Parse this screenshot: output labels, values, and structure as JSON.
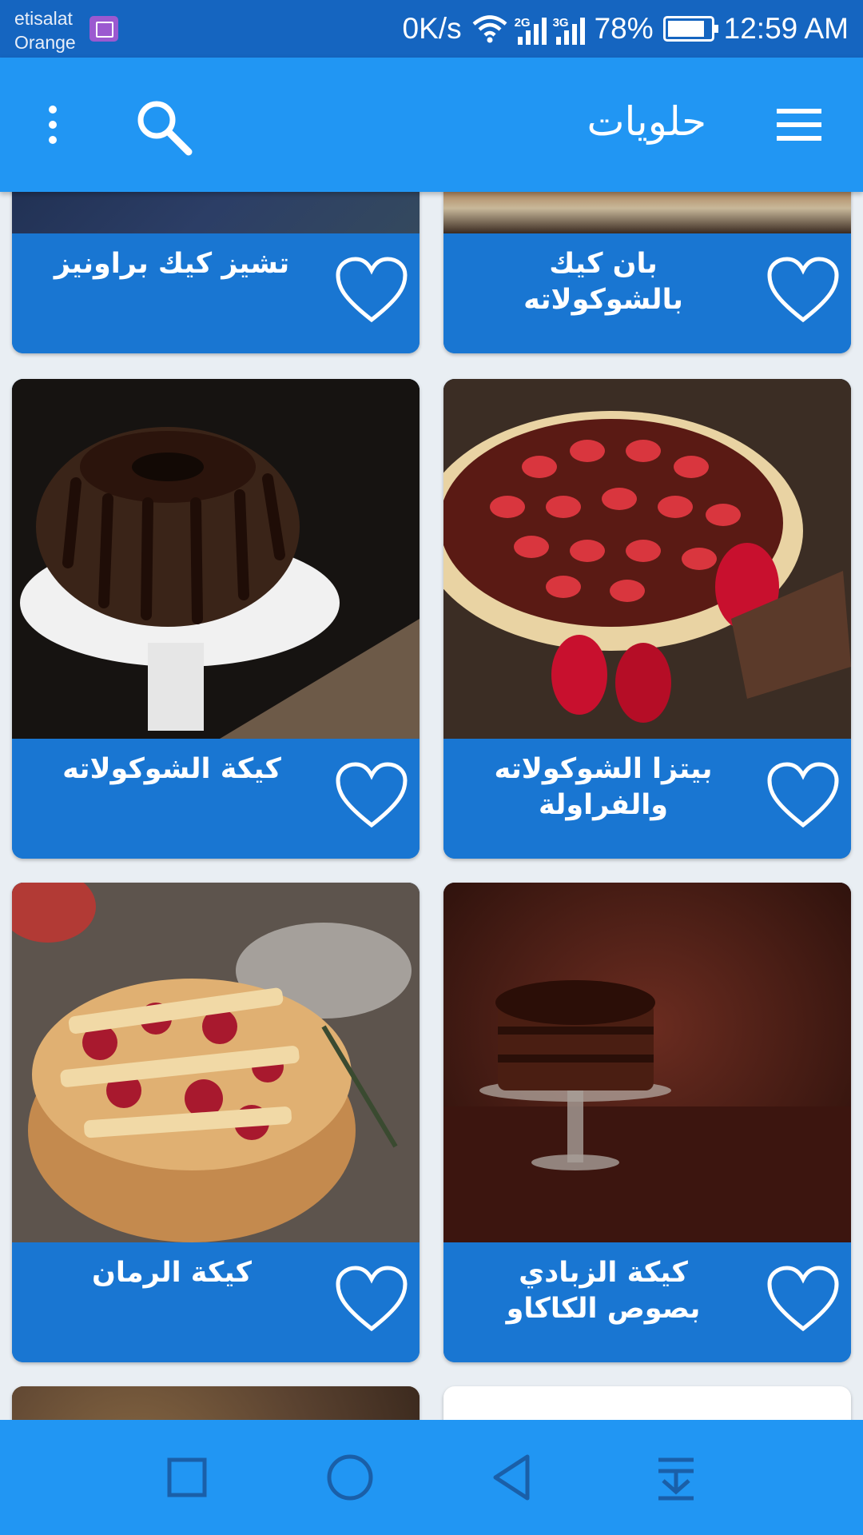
{
  "status_bar": {
    "carrier_line1": "etisalat",
    "carrier_line2": "Orange",
    "net_speed": "0K/s",
    "net_type_1": "2G",
    "net_type_2": "3G",
    "battery": "78%",
    "time": "12:59 AM"
  },
  "app_bar": {
    "title": "حلويات",
    "menu_icon": "hamburger-icon",
    "search_icon": "search-icon",
    "more_icon": "more-vert-icon"
  },
  "cards": [
    {
      "title": "بان كيك بالشوكولاته"
    },
    {
      "title": "تشيز كيك براونيز"
    },
    {
      "title": "بيتزا الشوكولاته والفراولة"
    },
    {
      "title": "كيكة الشوكولاته"
    },
    {
      "title": "كيكة الزبادي بصوص الكاكاو"
    },
    {
      "title": "كيكة الرمان"
    }
  ],
  "nav_bar": {
    "recents_icon": "square-icon",
    "home_icon": "circle-icon",
    "back_icon": "triangle-back-icon",
    "notifications_icon": "pull-down-icon"
  },
  "colors": {
    "status_bar": "#1565c0",
    "app_bar": "#2196f3",
    "card_bar": "#1976d2"
  }
}
